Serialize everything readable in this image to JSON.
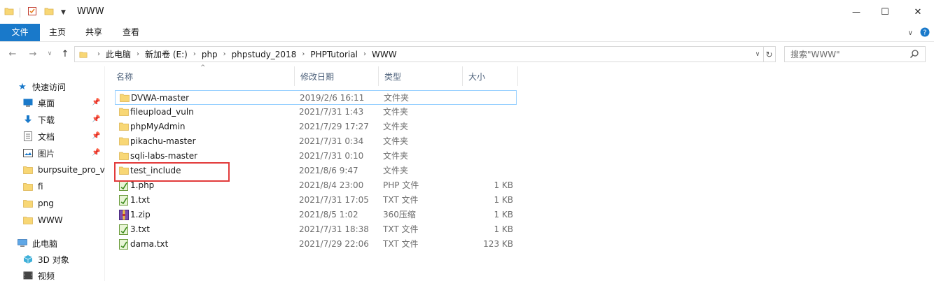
{
  "window": {
    "title": "WWW",
    "controls": {
      "minimize": "—",
      "maximize": "☐",
      "close": "✕"
    }
  },
  "ribbon": {
    "tabs": [
      "文件",
      "主页",
      "共享",
      "查看"
    ]
  },
  "address": {
    "crumbs": [
      "此电脑",
      "新加卷 (E:)",
      "php",
      "phpstudy_2018",
      "PHPTutorial",
      "WWW"
    ]
  },
  "search": {
    "placeholder": "搜索\"WWW\""
  },
  "sidebar": {
    "quick_access": "快速访问",
    "pinned": [
      {
        "label": "桌面",
        "icon": "desktop-icon"
      },
      {
        "label": "下载",
        "icon": "download-icon"
      },
      {
        "label": "文档",
        "icon": "document-icon"
      },
      {
        "label": "图片",
        "icon": "picture-icon"
      }
    ],
    "folders": [
      "burpsuite_pro_v",
      "fi",
      "png",
      "WWW"
    ],
    "this_pc": "此电脑",
    "pc_items": [
      {
        "label": "3D 对象",
        "icon": "3d-objects-icon"
      },
      {
        "label": "视频",
        "icon": "video-icon"
      }
    ]
  },
  "columns": {
    "name": "名称",
    "date": "修改日期",
    "type": "类型",
    "size": "大小"
  },
  "files": [
    {
      "name": "DVWA-master",
      "date": "2019/2/6 16:11",
      "type": "文件夹",
      "size": "",
      "kind": "folder",
      "selected": true
    },
    {
      "name": "fileupload_vuln",
      "date": "2021/7/31 1:43",
      "type": "文件夹",
      "size": "",
      "kind": "folder"
    },
    {
      "name": "phpMyAdmin",
      "date": "2021/7/29 17:27",
      "type": "文件夹",
      "size": "",
      "kind": "folder"
    },
    {
      "name": "pikachu-master",
      "date": "2021/7/31 0:34",
      "type": "文件夹",
      "size": "",
      "kind": "folder"
    },
    {
      "name": "sqli-labs-master",
      "date": "2021/7/31 0:10",
      "type": "文件夹",
      "size": "",
      "kind": "folder"
    },
    {
      "name": "test_include",
      "date": "2021/8/6 9:47",
      "type": "文件夹",
      "size": "",
      "kind": "folder",
      "highlighted": true
    },
    {
      "name": "1.php",
      "date": "2021/8/4 23:00",
      "type": "PHP 文件",
      "size": "1 KB",
      "kind": "text"
    },
    {
      "name": "1.txt",
      "date": "2021/7/31 17:05",
      "type": "TXT 文件",
      "size": "1 KB",
      "kind": "text"
    },
    {
      "name": "1.zip",
      "date": "2021/8/5 1:02",
      "type": "360压缩",
      "size": "1 KB",
      "kind": "zip"
    },
    {
      "name": "3.txt",
      "date": "2021/7/31 18:38",
      "type": "TXT 文件",
      "size": "1 KB",
      "kind": "text"
    },
    {
      "name": "dama.txt",
      "date": "2021/7/29 22:06",
      "type": "TXT 文件",
      "size": "123 KB",
      "kind": "text"
    }
  ],
  "colors": {
    "file_tab": "#1979ca",
    "folder": "#f8d775",
    "selection_border": "#99d1ff",
    "annotation": "#e23b3b"
  }
}
